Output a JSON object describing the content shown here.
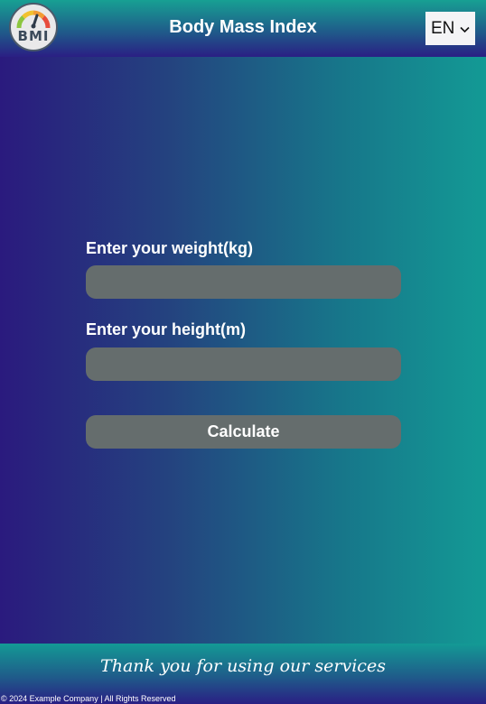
{
  "header": {
    "logo_text": "BMI",
    "title": "Body Mass Index",
    "language": {
      "selected": "EN"
    }
  },
  "form": {
    "weight_label": "Enter your weight(kg)",
    "weight_value": "",
    "height_label": "Enter your height(m)",
    "height_value": "",
    "calculate_label": "Calculate"
  },
  "footer": {
    "thanks": "Thank you for using our services",
    "copyright": "© 2024 Example Company | All Rights Reserved"
  },
  "colors": {
    "field_bg": "#656d6d",
    "gradient_left": "#2a1a7e",
    "gradient_right": "#139a95"
  },
  "icons": {
    "logo": "bmi-gauge-icon",
    "dropdown": "chevron-down-icon"
  }
}
